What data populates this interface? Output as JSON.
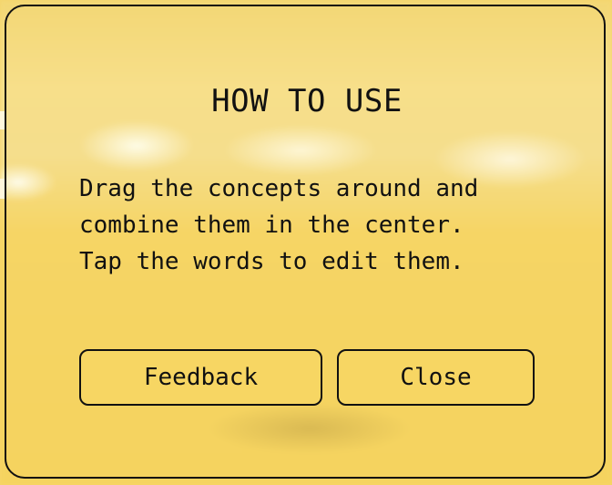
{
  "dialog": {
    "title": "HOW TO USE",
    "lines": [
      "Drag the concepts around and",
      "combine them in the center.",
      "Tap the words to edit them."
    ],
    "buttons": {
      "feedback_label": "Feedback",
      "close_label": "Close"
    }
  },
  "colors": {
    "background": "#f6d66a",
    "border": "#111111",
    "text": "#111111"
  }
}
